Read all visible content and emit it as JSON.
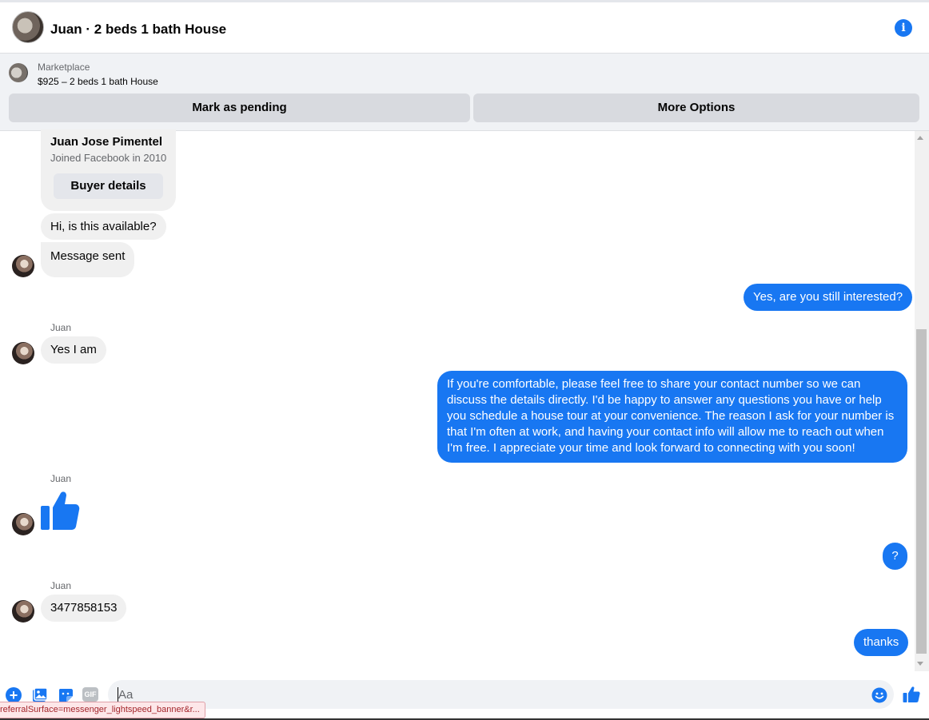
{
  "header": {
    "title": "Juan · 2 beds 1 bath House",
    "info_icon": "info-icon"
  },
  "marketplace": {
    "label": "Marketplace",
    "listing": "$925 – 2 beds 1 bath House",
    "pending_button": "Mark as pending",
    "more_button": "More Options"
  },
  "buyer": {
    "name": "Juan Jose Pimentel",
    "joined": "Joined Facebook in 2010",
    "details_button": "Buyer details"
  },
  "messages": [
    {
      "from": "them",
      "text": "Hi, is this available?"
    },
    {
      "from": "them",
      "text": "Message sent"
    },
    {
      "from": "me",
      "text": "Yes, are you still interested?"
    },
    {
      "from": "them",
      "sender": "Juan",
      "text": "Yes I am"
    },
    {
      "from": "me",
      "text": "If you're comfortable, please feel free to share your contact number so we can discuss the details directly. I'd be happy to answer any questions you have or help you schedule a house tour at your convenience. The reason I ask for your number is that I'm often at work, and having your contact info will allow me to reach out when I'm free. I appreciate your time and look forward to connecting with you soon!"
    },
    {
      "from": "them",
      "sender": "Juan",
      "icon": "thumbs-up-icon"
    },
    {
      "from": "me",
      "text": "?"
    },
    {
      "from": "them",
      "sender": "Juan",
      "text": "3477858153"
    },
    {
      "from": "me",
      "text": "thanks"
    }
  ],
  "composer": {
    "placeholder": "Aa",
    "gif_label": "GIF",
    "icons": [
      "plus-icon",
      "photo-icon",
      "sticker-icon",
      "gif-icon",
      "emoji-icon",
      "like-icon"
    ]
  },
  "status_bar": {
    "url": "referralSurface=messenger_lightspeed_banner&r..."
  },
  "colors": {
    "accent": "#1877f2",
    "incoming_bubble": "#f0f0f0",
    "panel_bg": "#f0f2f5"
  }
}
